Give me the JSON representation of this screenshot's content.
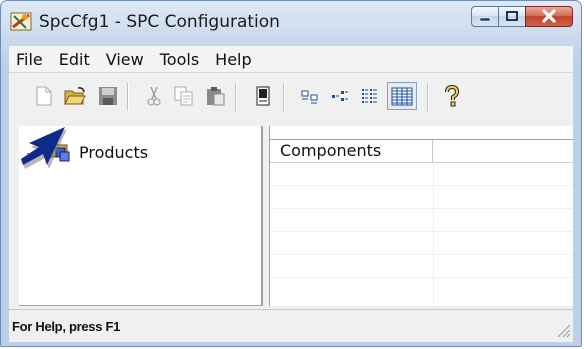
{
  "window": {
    "title": "SpcCfg1 - SPC Configuration"
  },
  "menu": {
    "items": [
      "File",
      "Edit",
      "View",
      "Tools",
      "Help"
    ]
  },
  "toolbar": {
    "buttons": [
      "new-icon",
      "open-icon",
      "save-icon",
      "cut-icon",
      "copy-icon",
      "paste-icon",
      "properties-icon",
      "large-icons-icon",
      "small-icons-icon",
      "list-icon",
      "details-icon",
      "help-icon"
    ],
    "pressed": "details-icon"
  },
  "tree": {
    "root_label": "Products"
  },
  "list": {
    "columns": [
      "Components",
      ""
    ]
  },
  "status": {
    "text": "For Help, press F1"
  }
}
